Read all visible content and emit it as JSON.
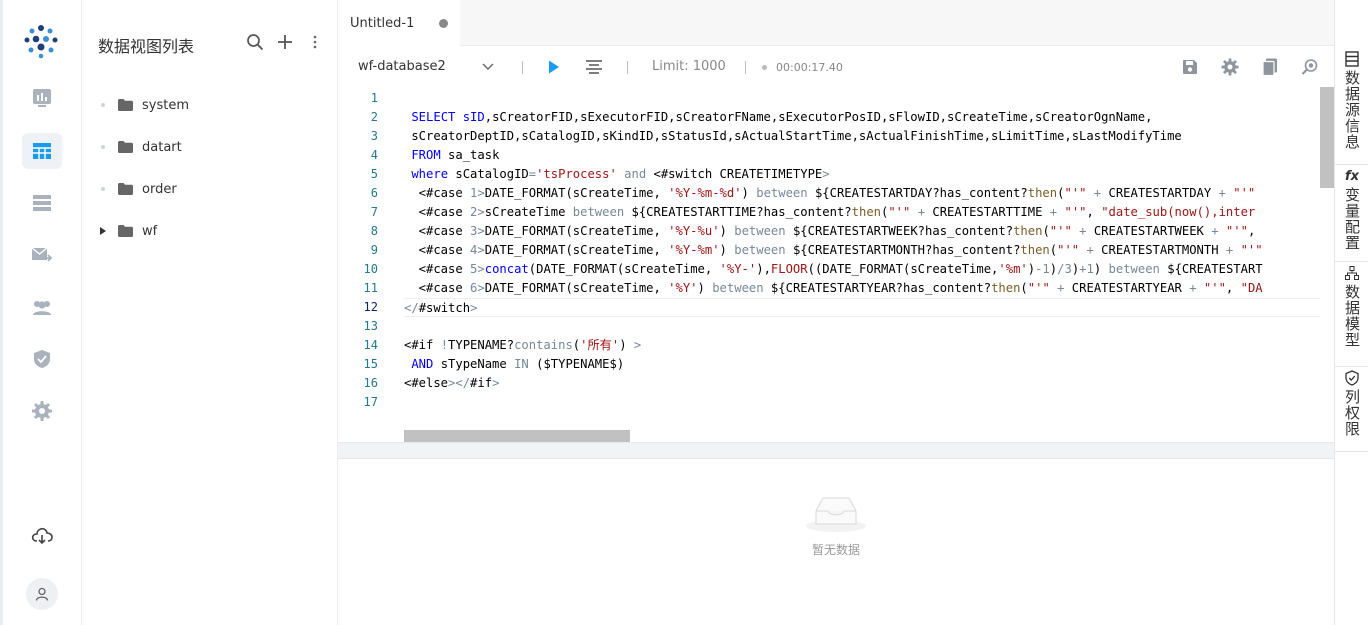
{
  "panel": {
    "title": "数据视图列表"
  },
  "tree": [
    {
      "label": "system",
      "expandable": false
    },
    {
      "label": "datart",
      "expandable": false
    },
    {
      "label": "order",
      "expandable": false
    },
    {
      "label": "wf",
      "expandable": true
    }
  ],
  "tab": {
    "label": "Untitled-1"
  },
  "toolbar": {
    "source": "wf-database2",
    "limit": "Limit: 1000",
    "elapsed": "00:00:17.40"
  },
  "editor": {
    "line_numbers": [
      "1",
      "2",
      "3",
      "4",
      "5",
      "6",
      "7",
      "8",
      "9",
      "10",
      "11",
      "12",
      "13",
      "14",
      "15",
      "16",
      "17"
    ],
    "current_line": "12"
  },
  "result": {
    "empty_text": "暂无数据"
  },
  "right_tabs": [
    {
      "icon": "table-list-icon",
      "label": "数据源信息"
    },
    {
      "icon": "fx-icon",
      "icon_text": "fx",
      "label": "变量配置"
    },
    {
      "icon": "hierarchy-icon",
      "label": "数据模型"
    },
    {
      "icon": "shield-check-icon",
      "label": "列权限"
    }
  ],
  "colors": {
    "keyword": "#0000ff",
    "string": "#a31515",
    "line_number": "#237893",
    "run_button": "#1b9aee"
  }
}
